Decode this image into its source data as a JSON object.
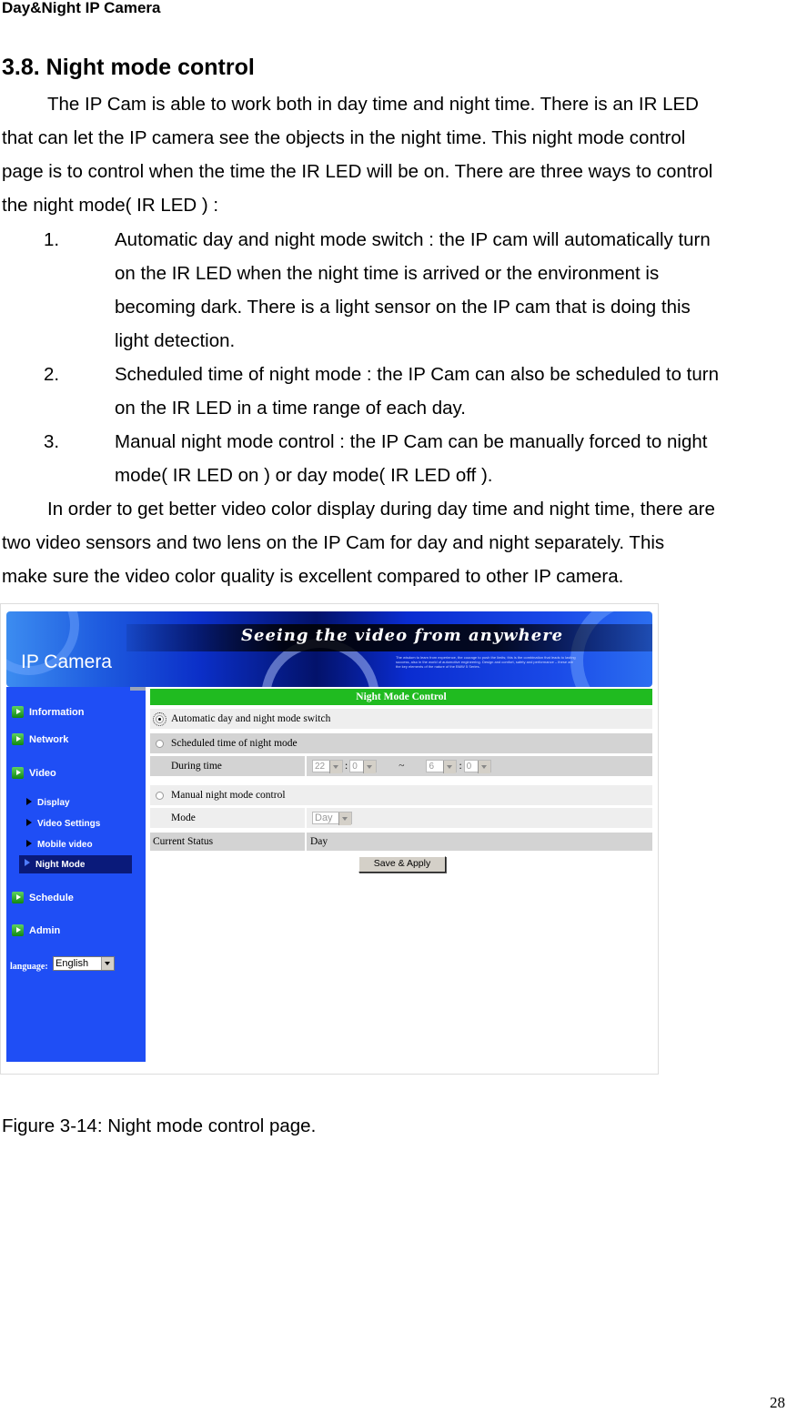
{
  "document": {
    "running_header": "Day&Night IP Camera",
    "section_title": "3.8. Night mode control",
    "intro_lines": [
      "The IP Cam is able to work both in day time and night time. There is an IR LED",
      "that can let the IP camera see the objects in the night time. This night mode control",
      "page is to control when the time the IR LED will be on. There are three ways to control",
      "the night mode( IR LED ) :"
    ],
    "list": [
      {
        "num": "1.",
        "lines": [
          "Automatic day and night mode switch : the IP cam will automatically turn",
          "on the IR LED when the night time is arrived or the environment is",
          "becoming dark. There is a light sensor on the IP cam that is doing this",
          "light detection."
        ]
      },
      {
        "num": "2.",
        "lines": [
          "Scheduled time of night mode : the IP Cam can also be scheduled to turn",
          "on the IR LED in a time range of each day."
        ]
      },
      {
        "num": "3.",
        "lines": [
          "Manual night mode control : the IP Cam can be manually forced to night",
          "mode( IR LED on ) or day mode( IR LED off )."
        ]
      }
    ],
    "outro_lines": [
      "In order to get better video color display during day time and night time, there are",
      "two video sensors and two lens on the IP Cam for day and night separately. This",
      "make sure the video color quality is excellent compared to other IP camera."
    ],
    "caption": "Figure 3-14: Night mode control page.",
    "page_number": "28"
  },
  "screenshot": {
    "banner": {
      "logo": "IP Camera",
      "slogan": "Seeing the video from anywhere",
      "blurb": "The wisdom to learn from experience, the courage to push the limits; this is the combination that leads to lasting success, also in the world of automotive engineering. Design and comfort, safety and performance – these are the key elements of the nature of the BMW 5 Series."
    },
    "sidebar": {
      "items": [
        {
          "label": "Information",
          "icon": "play-icon"
        },
        {
          "label": "Network",
          "icon": "play-icon"
        },
        {
          "label": "Video",
          "icon": "play-icon"
        },
        {
          "label": "Schedule",
          "icon": "play-icon"
        },
        {
          "label": "Admin",
          "icon": "play-icon"
        }
      ],
      "video_subitems": [
        {
          "label": "Display"
        },
        {
          "label": "Video Settings"
        },
        {
          "label": "Mobile video"
        },
        {
          "label": "Night Mode",
          "active": true
        }
      ],
      "language_label": "language:",
      "language_value": "English"
    },
    "panel": {
      "title": "Night Mode Control",
      "option_auto": "Automatic day and night mode switch",
      "option_scheduled": "Scheduled time of night mode",
      "during_time_label": "During time",
      "start_hour": "22",
      "start_minute": "0",
      "separator": ":",
      "range_sep": "~",
      "end_hour": "6",
      "end_minute": "0",
      "option_manual": "Manual night mode control",
      "mode_label": "Mode",
      "mode_value": "Day",
      "status_label": "Current Status",
      "status_value": "Day",
      "save_button": "Save & Apply",
      "selected_option": "auto"
    },
    "colors": {
      "sidebar_bg": "#1f4ef5",
      "sidebar_active_bg": "#0a1a7a",
      "header_green": "#20bb20",
      "row_light": "#eeeeee",
      "row_gray": "#d3d3d3"
    }
  }
}
